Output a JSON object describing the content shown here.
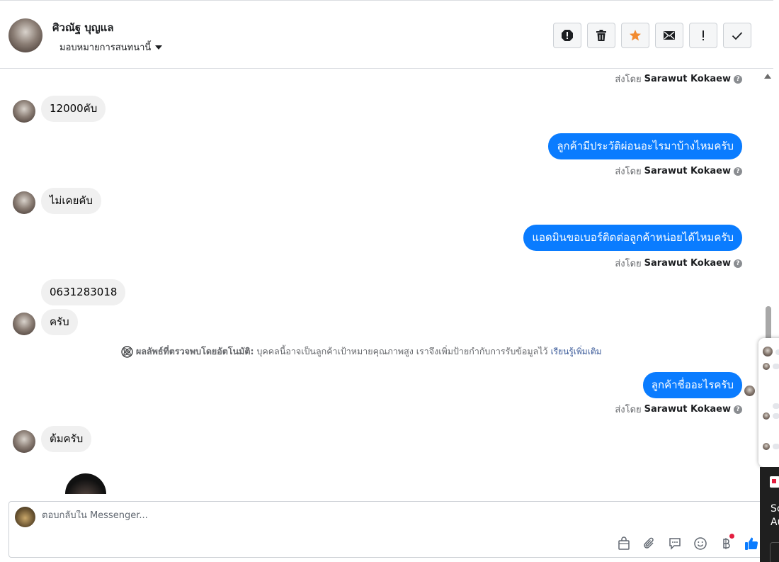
{
  "header": {
    "contact_name": "ศิวณัฐ บุญแล",
    "assign_label": "มอบหมายการสนทนานี้",
    "tools": [
      {
        "name": "spam-button",
        "icon": "stop-alert-icon"
      },
      {
        "name": "delete-button",
        "icon": "trash-icon"
      },
      {
        "name": "star-button",
        "icon": "star-icon",
        "color": "#f28b30"
      },
      {
        "name": "mark-unread-button",
        "icon": "envelope-icon"
      },
      {
        "name": "follow-up-button",
        "icon": "exclamation-icon"
      },
      {
        "name": "mark-done-button",
        "icon": "check-icon"
      }
    ]
  },
  "conversation": {
    "sent_by_prefix": "ส่งโดย",
    "agent_name": "Sarawut Kokaew",
    "messages": [
      {
        "direction": "in",
        "text": "12000คับ"
      },
      {
        "direction": "out",
        "text": "ลูกค้ามีประวัติผ่อนอะไรมาบ้างไหมครับ"
      },
      {
        "direction": "in",
        "text": "ไม่เคยคับ"
      },
      {
        "direction": "out",
        "text": "แอดมินขอเบอร์ติดต่อลูกค้าหน่อยได้ไหมครับ"
      },
      {
        "direction": "in",
        "text": "0631283018"
      },
      {
        "direction": "in",
        "text": "ครับ"
      },
      {
        "direction": "out",
        "text": "ลูกค้าชื่ออะไรครับ"
      },
      {
        "direction": "in",
        "text": "ต้มครับ"
      }
    ],
    "auto_detect": {
      "title": "ผลลัพธ์ที่ตรวจพบโดยอัตโนมัติ:",
      "body": "บุคคลนี้อาจเป็นลูกค้าเป้าหมายคุณภาพสูง เราจึงเพิ่มป้ายกำกับการรับข้อมูลไว้",
      "link": "เรียนรู้เพิ่มเติม"
    }
  },
  "composer": {
    "placeholder": "ตอบกลับใน Messenger...",
    "tools": [
      "bag-icon",
      "paperclip-icon",
      "saved-reply-icon",
      "emoji-icon",
      "baht-icon",
      "thumbs-up-icon"
    ],
    "like_color": "#0a7cff"
  },
  "side_panel": {
    "text_line1": "Sc",
    "text_line2": "Au"
  },
  "colors": {
    "outgoing_bubble": "#0a7cff",
    "incoming_bubble": "#f0f0f0"
  }
}
